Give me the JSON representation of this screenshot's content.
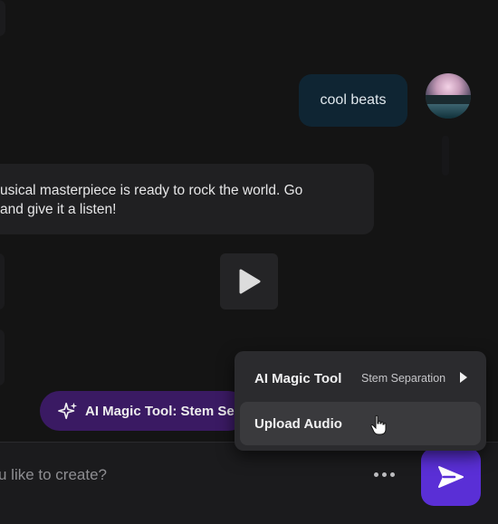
{
  "chat": {
    "user_message": "cool beats",
    "bot_message_line1": "usical masterpiece is ready to rock the world. Go",
    "bot_message_line2": "and give it a listen!"
  },
  "chip": {
    "label": "AI Magic Tool: Stem Sep"
  },
  "menu": {
    "items": [
      {
        "label": "AI Magic Tool",
        "sublabel": "Stem Separation"
      },
      {
        "label": "Upload Audio"
      }
    ]
  },
  "composer": {
    "placeholder": "u like to create?"
  },
  "colors": {
    "accent": "#5a2fd6",
    "chip_bg": "#3a1a63",
    "background": "#141414"
  },
  "icons": [
    "avatar-image",
    "play-icon",
    "sparkle-icon",
    "more-icon",
    "send-icon",
    "chevron-right-icon",
    "hand-cursor-icon"
  ]
}
